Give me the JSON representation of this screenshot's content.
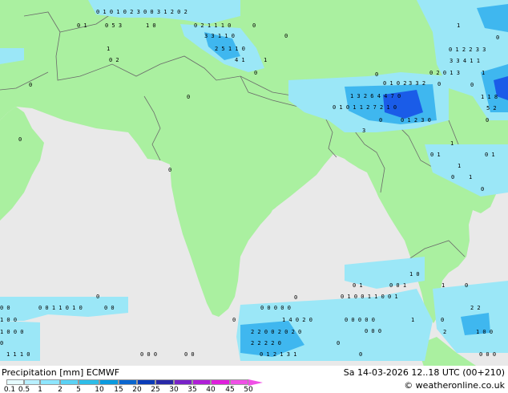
{
  "title": "Precipitation [mm]  ECMWF",
  "valid": "Sa 14-03-2026 12..18 UTC (00+210)",
  "copyright": "© weatheronline.co.uk",
  "colorbar": {
    "ticks": [
      "0.1",
      "0.5",
      "1",
      "2",
      "5",
      "10",
      "15",
      "20",
      "25",
      "30",
      "35",
      "40",
      "45",
      "50"
    ],
    "colors": [
      "#e6fbff",
      "#b8f0ff",
      "#8ee6ff",
      "#5ad2f5",
      "#2ebde8",
      "#0a9be0",
      "#0a66cf",
      "#0a3cb8",
      "#2828a8",
      "#7822c8",
      "#b01ed8",
      "#e01edc",
      "#f050e6"
    ]
  },
  "colors": {
    "land": "#aaf0a0",
    "sea": "#e9e9e9",
    "border": "#6a6a6a",
    "precip_light": "#9be7f7",
    "precip_mid": "#3fb7ef",
    "precip_heavy": "#1a5ce8"
  },
  "map_labels": [
    {
      "t": "0 1 0 1 0 2 3 0 0 3 1 2 0 2"
    },
    {
      "t": "0 1"
    },
    {
      "t": "0 5 3"
    },
    {
      "t": "1 0"
    },
    {
      "t": "0 2 1 1 1 0"
    },
    {
      "t": "0"
    },
    {
      "t": "3 3 1 1 0"
    },
    {
      "t": "1"
    },
    {
      "t": "0"
    },
    {
      "t": "2 5 1 1 0"
    },
    {
      "t": "0 2"
    },
    {
      "t": "4 1"
    },
    {
      "t": "1"
    },
    {
      "t": "0"
    },
    {
      "t": "0"
    },
    {
      "t": "0"
    },
    {
      "t": "0 1 0 2"
    },
    {
      "t": "1 3 2 6 4 4 7 0"
    },
    {
      "t": "0 1 0 1 1 2 7 2 1 0"
    },
    {
      "t": "0 1 2 3 0"
    },
    {
      "t": "3"
    },
    {
      "t": "0"
    },
    {
      "t": "3 3 2"
    },
    {
      "t": "0"
    },
    {
      "t": "0 1 2 2 3 3"
    },
    {
      "t": "0"
    },
    {
      "t": "3 3 4 1 1"
    },
    {
      "t": "1"
    },
    {
      "t": "0 2 0 1 3"
    },
    {
      "t": "1"
    },
    {
      "t": "0"
    },
    {
      "t": "1 1 8"
    },
    {
      "t": "5 2"
    },
    {
      "t": "0"
    },
    {
      "t": "0"
    },
    {
      "t": "1"
    },
    {
      "t": "0 1"
    },
    {
      "t": "0 1"
    },
    {
      "t": "1"
    },
    {
      "t": "0"
    },
    {
      "t": "1"
    },
    {
      "t": "0"
    },
    {
      "t": "0"
    },
    {
      "t": "0"
    },
    {
      "t": "1 0"
    },
    {
      "t": "0 1"
    },
    {
      "t": "0 0 1"
    },
    {
      "t": "0 1 0 0 1 1 0 0 1"
    },
    {
      "t": "1"
    },
    {
      "t": "0"
    },
    {
      "t": "0"
    },
    {
      "t": "0 0 1 1 0 1 0"
    },
    {
      "t": "0 0"
    },
    {
      "t": "0 0"
    },
    {
      "t": "1 0 0"
    },
    {
      "t": "1 0 0 0"
    },
    {
      "t": "1 1 1 0"
    },
    {
      "t": "0 0 0"
    },
    {
      "t": "0 0"
    },
    {
      "t": "0 0 0 0 0"
    },
    {
      "t": "0"
    },
    {
      "t": "1 4 0 2 0"
    },
    {
      "t": "2 2 0 0 2 0 2 0"
    },
    {
      "t": "2 2 2 2 0"
    },
    {
      "t": "0 1 2 1 3 1"
    },
    {
      "t": "0 0 0 0 0"
    },
    {
      "t": "0 0 0"
    },
    {
      "t": "0"
    },
    {
      "t": "0"
    },
    {
      "t": "1"
    },
    {
      "t": "2 2"
    },
    {
      "t": "1 0 0"
    },
    {
      "t": "0"
    },
    {
      "t": "0"
    },
    {
      "t": "0"
    },
    {
      "t": "0 0 0"
    },
    {
      "t": "2"
    }
  ]
}
